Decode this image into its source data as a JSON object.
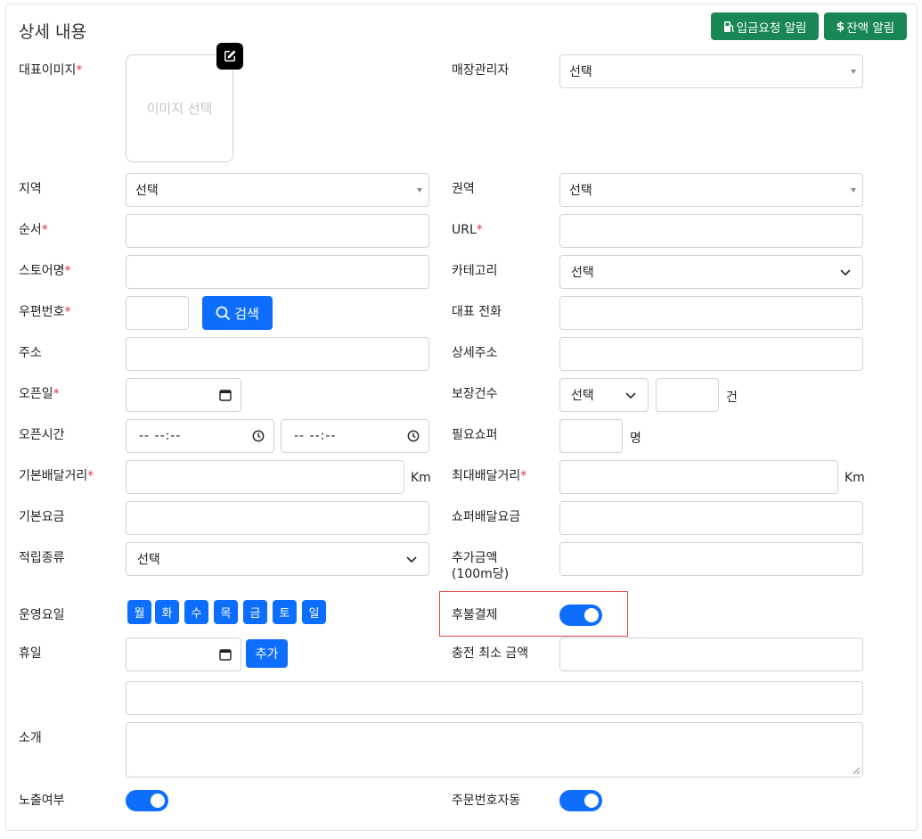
{
  "header": {
    "title": "상세 내용",
    "deposit_alert_label": "입금요청 알림",
    "balance_alert_label": "잔액 알림"
  },
  "fields": {
    "main_image": {
      "label": "대표이미지",
      "placeholder": "이미지 선택"
    },
    "store_manager": {
      "label": "매장관리자",
      "value": "선택"
    },
    "region": {
      "label": "지역",
      "value": "선택"
    },
    "zone": {
      "label": "권역",
      "value": "선택"
    },
    "order": {
      "label": "순서",
      "value": ""
    },
    "url": {
      "label": "URL",
      "value": ""
    },
    "store_name": {
      "label": "스토어명",
      "value": ""
    },
    "category": {
      "label": "카테고리",
      "value": "선택"
    },
    "postal_code": {
      "label": "우편번호",
      "value": "",
      "search_label": "검색"
    },
    "main_phone": {
      "label": "대표 전화",
      "value": ""
    },
    "address": {
      "label": "주소",
      "value": ""
    },
    "detail_address": {
      "label": "상세주소",
      "value": ""
    },
    "open_date": {
      "label": "오픈일",
      "value": ""
    },
    "guarantee_count": {
      "label": "보장건수",
      "value": "선택",
      "unit": "건"
    },
    "open_time": {
      "label": "오픈시간",
      "start": "-- --:--",
      "end": "-- --:--"
    },
    "required_shopper": {
      "label": "필요쇼퍼",
      "unit": "명"
    },
    "base_distance": {
      "label": "기본배달거리",
      "unit": "Km"
    },
    "max_distance": {
      "label": "최대배달거리",
      "unit": "Km"
    },
    "base_fee": {
      "label": "기본요금"
    },
    "shopper_fee": {
      "label": "쇼퍼배달요금"
    },
    "point_type": {
      "label": "적립종류",
      "value": "선택"
    },
    "extra_fee": {
      "label_line1": "추가금액",
      "label_line2": "(100m당)"
    },
    "operating_days": {
      "label": "운영요일",
      "days": [
        "월",
        "화",
        "수",
        "목",
        "금",
        "토",
        "일"
      ]
    },
    "postpaid": {
      "label": "후불결제",
      "enabled": true
    },
    "holiday": {
      "label": "휴일",
      "add_label": "추가"
    },
    "min_charge": {
      "label": "충전 최소 금액"
    },
    "intro": {
      "label": "소개"
    },
    "exposure": {
      "label": "노출여부",
      "enabled": true
    },
    "auto_order_number": {
      "label": "주문번호자동",
      "enabled": true
    }
  },
  "required_mark": "*",
  "colors": {
    "primary": "#0d6efd",
    "success": "#198754",
    "required": "#dc3545",
    "highlight": "#e0474c"
  }
}
